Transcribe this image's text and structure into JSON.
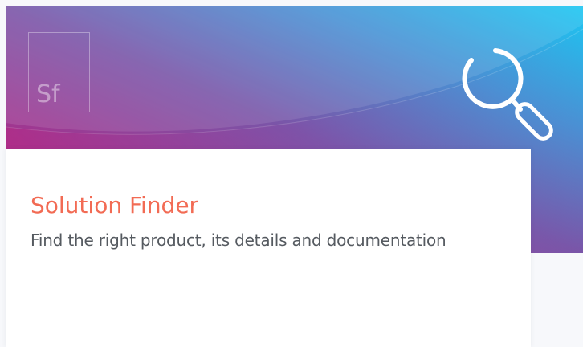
{
  "hero": {
    "logo_text": "Sf",
    "icon": "search-icon",
    "gradient_colors": [
      "#1cc6f2",
      "#4b8fd3",
      "#7a55a8",
      "#a2358f",
      "#c5227a"
    ]
  },
  "card": {
    "title": "Solution Finder",
    "description": "Find the right product, its details and documentation",
    "title_color": "#f26b54",
    "description_color": "#555a60"
  }
}
